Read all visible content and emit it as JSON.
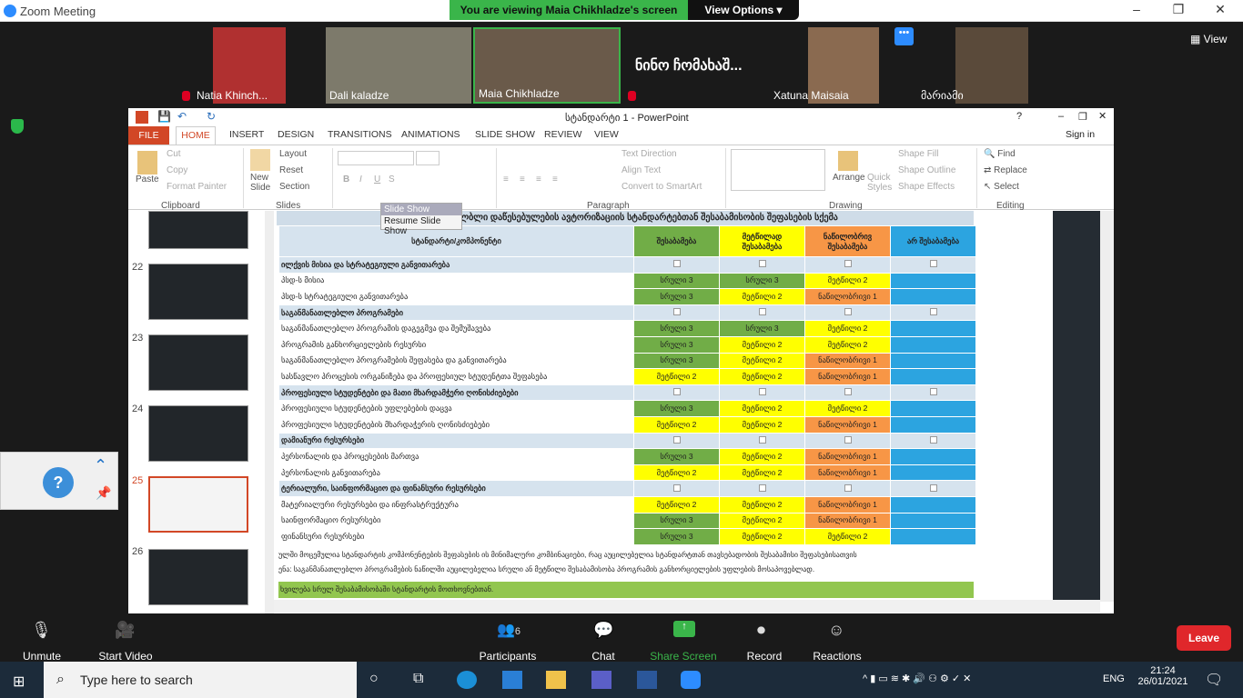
{
  "app_title": "Zoom Meeting",
  "banner": {
    "viewing": "You are viewing Maia Chikhladze's screen",
    "view_options": "View Options"
  },
  "participants": [
    {
      "name": "Natia Khinch..."
    },
    {
      "name": "Dali kaladze"
    },
    {
      "name": "Maia Chikhladze"
    },
    {
      "name": "ნინო ჩომახაშ..."
    },
    {
      "name": "Xatuna Maisaia"
    },
    {
      "name": "მარიამი"
    }
  ],
  "view_button": "View",
  "ppt": {
    "title": "სტანდარტი 1 - PowerPoint",
    "signin": "Sign in",
    "tabs": [
      "FILE",
      "HOME",
      "INSERT",
      "DESIGN",
      "TRANSITIONS",
      "ANIMATIONS",
      "SLIDE SHOW",
      "REVIEW",
      "VIEW"
    ],
    "clipboard": {
      "paste": "Paste",
      "cut": "Cut",
      "copy": "Copy",
      "format_painter": "Format Painter",
      "group": "Clipboard"
    },
    "slides": {
      "new_slide": "New Slide",
      "layout": "Layout",
      "reset": "Reset",
      "section": "Section",
      "group": "Slides"
    },
    "paragraph": {
      "text_direction": "Text Direction",
      "align_text": "Align Text",
      "convert": "Convert to SmartArt",
      "group": "Paragraph"
    },
    "drawing": {
      "arrange": "Arrange",
      "quick_styles": "Quick Styles",
      "shape_fill": "Shape Fill",
      "shape_outline": "Shape Outline",
      "shape_effects": "Shape Effects",
      "group": "Drawing"
    },
    "editing": {
      "find": "Find",
      "replace": "Replace",
      "select": "Select",
      "group": "Editing"
    },
    "slide_numbers": [
      "22",
      "23",
      "24",
      "25",
      "26"
    ],
    "tooltip": {
      "title": "Slide Show",
      "item": "Resume Slide Show"
    }
  },
  "slide": {
    "header_title": "პროგ...   ...ულბლი დაწესებულების ავტორიზაციის სტანდარტებთან შესაბამისობის შეფასების სქემა",
    "col_headers": [
      "სტანდარტი/კომპონენტი",
      "შესაბამება",
      "მეტწილად შესაბამება",
      "ნაწილობრივ შესაბამება",
      "არ შესაბამება"
    ],
    "rows": [
      {
        "type": "section",
        "label": "ილქვის მისია და სტრატეგიული განვითარება"
      },
      {
        "type": "row",
        "label": "პსდ-ს მისია",
        "c": [
          "სრული 3",
          "სრული 3",
          "მეტწილი 2",
          ""
        ],
        "k": [
          "g",
          "g",
          "y",
          "b"
        ]
      },
      {
        "type": "row",
        "label": "პსდ-ს სტრატეგიული განვითარება",
        "c": [
          "სრული 3",
          "მეტწილი 2",
          "ნაწილობრივი 1",
          ""
        ],
        "k": [
          "g",
          "y",
          "o",
          "b"
        ]
      },
      {
        "type": "section",
        "label": "საგანმანათლებლო პროგრამები"
      },
      {
        "type": "row",
        "label": "საგანმანათლებლო პროგრამის  დაგეგმვა და შემუშავება",
        "c": [
          "სრული 3",
          "სრული 3",
          "მეტწილი 2",
          ""
        ],
        "k": [
          "g",
          "g",
          "y",
          "b"
        ]
      },
      {
        "type": "row",
        "label": "პროგრამის განხორციელების რესურსი",
        "c": [
          "სრული 3",
          "მეტწილი 2",
          "მეტწილი 2",
          ""
        ],
        "k": [
          "g",
          "y",
          "y",
          "b"
        ]
      },
      {
        "type": "row",
        "label": "საგანმანათლებლო პროგრამების  შეფასება და განვითარება",
        "c": [
          "სრული 3",
          "მეტწილი 2",
          "ნაწილობრივი 1",
          ""
        ],
        "k": [
          "g",
          "y",
          "o",
          "b"
        ]
      },
      {
        "type": "row",
        "label": "სასწავლო პროცესის ორგანიზება და პროფესიულ სტუდენტთა  შეფასება",
        "c": [
          "მეტწილი 2",
          "მეტწილი 2",
          "ნაწილობრივი 1",
          ""
        ],
        "k": [
          "y",
          "y",
          "o",
          "b"
        ]
      },
      {
        "type": "section",
        "label": "პროფესიული სტუდენტები და მათი მხარდამჭერი ღონისძიებები"
      },
      {
        "type": "row",
        "label": "პროფესიული სტუდენტების უფლებების დაცვა",
        "c": [
          "სრული 3",
          "მეტწილი 2",
          "მეტწილი 2",
          ""
        ],
        "k": [
          "g",
          "y",
          "y",
          "b"
        ]
      },
      {
        "type": "row",
        "label": "პროფესიული სტუდენტების მხარდაჭერის ღონისძიებები",
        "c": [
          "მეტწილი 2",
          "მეტწილი 2",
          "ნაწილობრივი 1",
          ""
        ],
        "k": [
          "y",
          "y",
          "o",
          "b"
        ]
      },
      {
        "type": "section",
        "label": "დამიანური რესურსები"
      },
      {
        "type": "row",
        "label": "პერსონალის და პროცესების მართვა",
        "c": [
          "სრული 3",
          "მეტწილი 2",
          "ნაწილობრივი 1",
          ""
        ],
        "k": [
          "g",
          "y",
          "o",
          "b"
        ]
      },
      {
        "type": "row",
        "label": "პერსონალის განვითარება",
        "c": [
          "მეტწილი 2",
          "მეტწილი 2",
          "ნაწილობრივი 1",
          ""
        ],
        "k": [
          "y",
          "y",
          "o",
          "b"
        ]
      },
      {
        "type": "section",
        "label": "ტერიალური, საინფორმაციო და ფინანსური რესურსები"
      },
      {
        "type": "row",
        "label": "მატერიალური რესურსები და ინფრასტრუქტურა",
        "c": [
          "მეტწილი 2",
          "მეტწილი 2",
          "ნაწილობრივი 1",
          ""
        ],
        "k": [
          "y",
          "y",
          "o",
          "b"
        ]
      },
      {
        "type": "row",
        "label": "საინფორმაციო რესურსები",
        "c": [
          "სრული 3",
          "მეტწილი 2",
          "ნაწილობრივი 1",
          ""
        ],
        "k": [
          "g",
          "y",
          "o",
          "b"
        ]
      },
      {
        "type": "row",
        "label": "ფინანსური რესურსები",
        "c": [
          "სრული 3",
          "მეტწილი 2",
          "მეტწილი 2",
          ""
        ],
        "k": [
          "g",
          "y",
          "y",
          "b"
        ]
      }
    ],
    "note1": "ულში მოცემულია სტანდარტის კომპონენტების შეფასების ის მინიმალური კომბინაციები, რაც აუცილებელია სტანდარტთან თავსებადობის შესაბამისი შეფასებისათვის",
    "note2": "ენა: საგანმანათლებლო პროგრამების ნაწილში აუცილებელია სრული ან მეტწილი შესაბამისობა პროგრამის განხორციელების უფლების მოსაპოვებლად.",
    "green_bar": "ხვილება სრულ შესაბამისობაში სტანდარტის მოთხოვნებთან."
  },
  "zoom_controls": {
    "unmute": "Unmute",
    "start_video": "Start Video",
    "participants": "Participants",
    "participants_count": "6",
    "chat": "Chat",
    "share": "Share Screen",
    "record": "Record",
    "reactions": "Reactions",
    "leave": "Leave"
  },
  "taskbar": {
    "search": "Type here to search",
    "lang": "ENG",
    "time": "21:24",
    "date": "26/01/2021"
  },
  "colors": {
    "green": "#71ad47",
    "yellow": "#ffff00",
    "orange": "#f79646",
    "blue": "#2ca4e0",
    "zoom_blue": "#2D8CFF",
    "ppt_orange": "#D24726"
  }
}
